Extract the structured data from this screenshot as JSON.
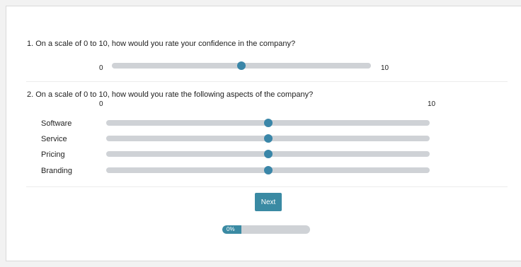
{
  "q1": {
    "text": "1. On a scale of 0 to 10, how would you rate your confidence in the company?",
    "min_label": "0",
    "max_label": "10",
    "value": 5
  },
  "q2": {
    "text": "2. On a scale of 0 to 10, how would you rate the following aspects of the company?",
    "min_label": "0",
    "max_label": "10",
    "rows": [
      {
        "label": "Software",
        "value": 5
      },
      {
        "label": "Service",
        "value": 5
      },
      {
        "label": "Pricing",
        "value": 5
      },
      {
        "label": "Branding",
        "value": 5
      }
    ]
  },
  "next_label": "Next",
  "progress": {
    "percent_text": "0%",
    "value": 0
  },
  "colors": {
    "accent": "#3a86a8",
    "track": "#cfd2d6"
  }
}
